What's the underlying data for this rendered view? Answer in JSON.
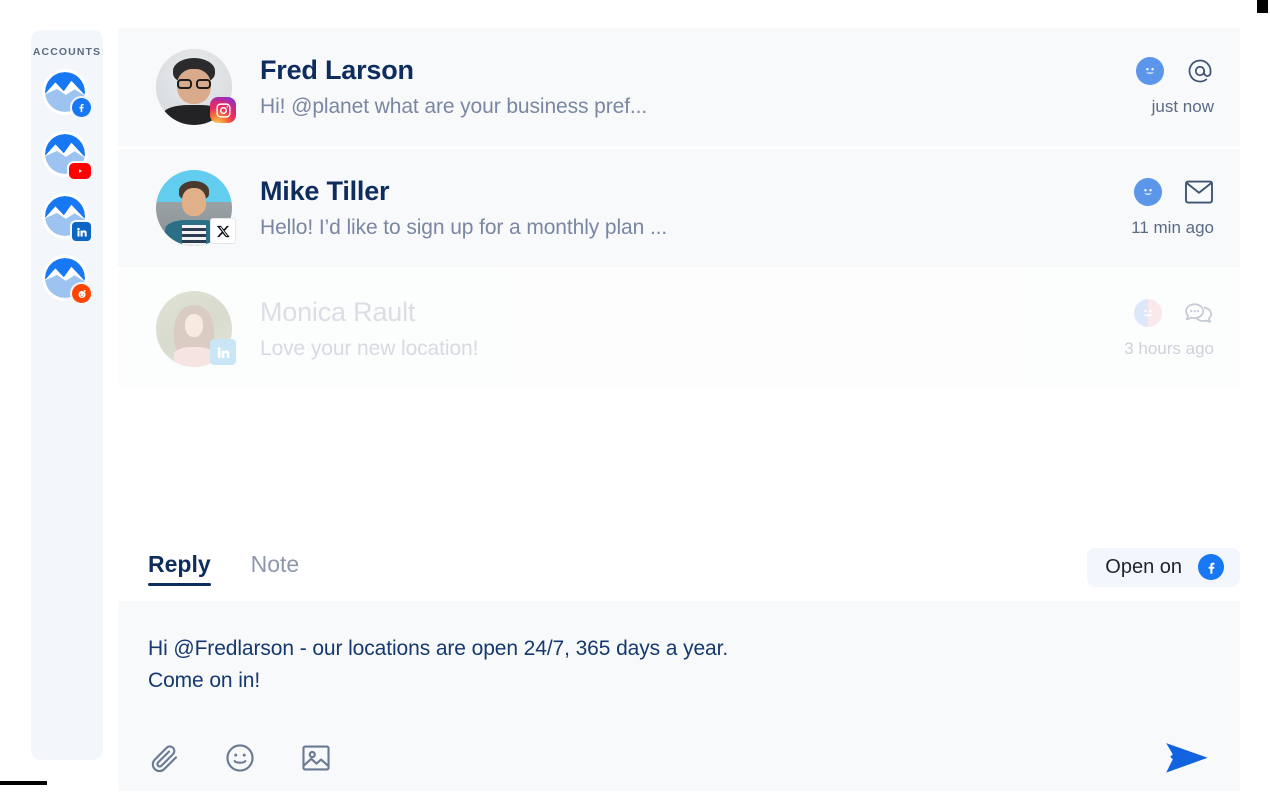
{
  "sidebar": {
    "title": "ACCOUNTS",
    "accounts": [
      {
        "name": "account-facebook",
        "platform": "facebook",
        "icon": "facebook-icon"
      },
      {
        "name": "account-youtube",
        "platform": "youtube",
        "icon": "youtube-icon"
      },
      {
        "name": "account-linkedin",
        "platform": "linkedin",
        "icon": "linkedin-icon"
      },
      {
        "name": "account-reddit",
        "platform": "reddit",
        "icon": "reddit-icon"
      }
    ]
  },
  "conversations": [
    {
      "name": "Fred Larson",
      "snippet": "Hi! @planet what are your business pref...",
      "time": "just now",
      "platform": "instagram",
      "status_icon": "smiley-face-icon",
      "type_icon": "at-mention-icon",
      "read": true
    },
    {
      "name": "Mike Tiller",
      "snippet": "Hello! I’d like to sign up for a monthly plan ...",
      "time": "11 min ago",
      "platform": "xtwitter",
      "status_icon": "smiley-face-icon",
      "type_icon": "envelope-icon",
      "read": true
    },
    {
      "name": "Monica Rault",
      "snippet": "Love your new location!",
      "time": "3 hours ago",
      "platform": "linkedin",
      "status_icon": "neutral-face-icon",
      "type_icon": "chat-bubbles-icon",
      "read": false
    }
  ],
  "reply": {
    "tabs": [
      {
        "label": "Reply",
        "active": true
      },
      {
        "label": "Note",
        "active": false
      }
    ],
    "open_on_label": "Open on",
    "open_on_platform": "facebook",
    "message": "Hi @Fredlarson - our locations are open 24/7, 365 days a year.\nCome on in!",
    "tools": [
      {
        "name": "attach-icon",
        "label": "attachment"
      },
      {
        "name": "emoji-icon",
        "label": "emoji"
      },
      {
        "name": "image-icon",
        "label": "image"
      }
    ],
    "send_label": "send-icon"
  },
  "colors": {
    "brand_blue": "#1263e0",
    "navy": "#0e2d5e",
    "muted": "#7a87a2",
    "panel": "#f8f9fa",
    "sidebar": "#f3f6fb",
    "facebook": "#1877f2",
    "youtube": "#ff0000",
    "linkedin": "#0a66c2",
    "reddit": "#ff4500"
  }
}
